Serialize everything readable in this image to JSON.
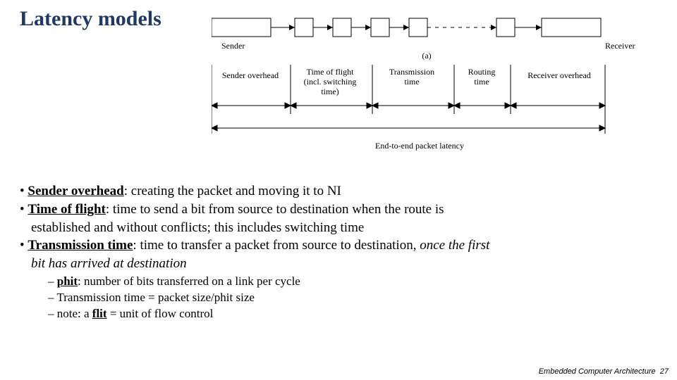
{
  "title": "Latency models",
  "diagram": {
    "sender": "Sender",
    "receiver": "Receiver",
    "fig_label": "(a)",
    "seg1": "Sender overhead",
    "seg2_l1": "Time of flight",
    "seg2_l2": "(incl. switching",
    "seg2_l3": "time)",
    "seg3_l1": "Transmission",
    "seg3_l2": "time",
    "seg4_l1": "Routing",
    "seg4_l2": "time",
    "seg5": "Receiver overhead",
    "end_to_end": "End-to-end packet latency"
  },
  "bullets": {
    "b1_term": "Sender overhead",
    "b1_rest": ": creating the packet and moving it to NI",
    "b2_term": "Time of flight",
    "b2_rest_a": ": time to send a bit from source to destination when the route is",
    "b2_rest_b": "established and without conflicts; this includes switching time",
    "b3_term": "Transmission time",
    "b3_rest_a": ": time to transfer a packet from source to destination, ",
    "b3_rest_b": "once the first",
    "b3_rest_c": "bit has arrived at destination",
    "s1_term": "phit",
    "s1_rest": ": number of bits transferred on a link per cycle",
    "s2": "Transmission time = packet size/phit size",
    "s3_pre": "note: a ",
    "s3_term": "flit",
    "s3_rest": " = unit of flow control"
  },
  "footer": {
    "course": "Embedded Computer Architecture",
    "num": "27"
  }
}
